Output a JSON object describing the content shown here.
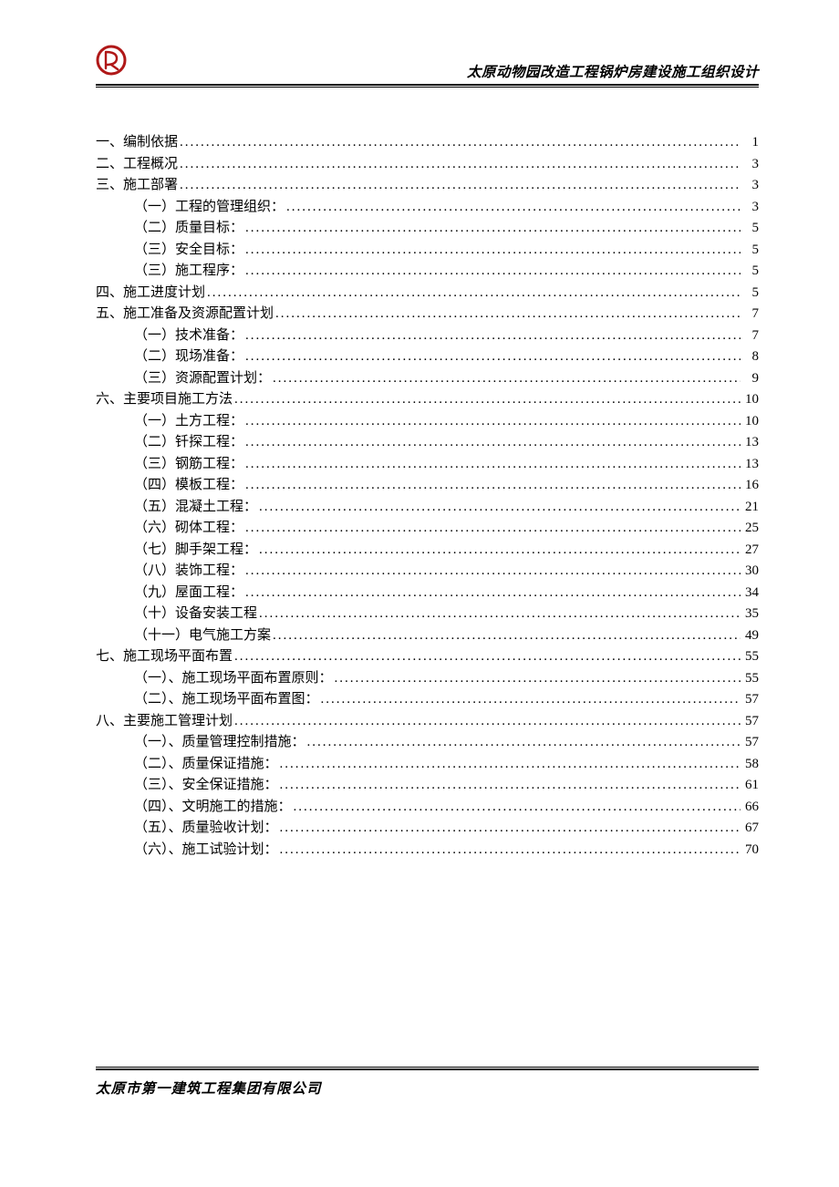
{
  "header": {
    "title": "太原动物园改造工程锅炉房建设施工组织设计"
  },
  "footer": {
    "company": "太原市第一建筑工程集团有限公司"
  },
  "toc": [
    {
      "level": 1,
      "label": "一、编制依据",
      "page": "1"
    },
    {
      "level": 1,
      "label": "二、工程概况",
      "page": "3"
    },
    {
      "level": 1,
      "label": "三、施工部署",
      "page": "3"
    },
    {
      "level": 2,
      "label": "（一）工程的管理组织：",
      "page": "3"
    },
    {
      "level": 2,
      "label": "（二）质量目标：",
      "page": "5"
    },
    {
      "level": 2,
      "label": "（三）安全目标：",
      "page": "5"
    },
    {
      "level": 2,
      "label": "（三）施工程序：",
      "page": "5"
    },
    {
      "level": 1,
      "label": "四、施工进度计划",
      "page": "5"
    },
    {
      "level": 1,
      "label": "五、施工准备及资源配置计划",
      "page": "7"
    },
    {
      "level": 2,
      "label": "（一）技术准备：",
      "page": "7"
    },
    {
      "level": 2,
      "label": "（二）现场准备：",
      "page": "8"
    },
    {
      "level": 2,
      "label": "（三）资源配置计划：",
      "page": "9"
    },
    {
      "level": 1,
      "label": "六、主要项目施工方法",
      "page": "10"
    },
    {
      "level": 2,
      "label": "（一）土方工程：",
      "page": "10"
    },
    {
      "level": 2,
      "label": "（二）钎探工程：",
      "page": "13"
    },
    {
      "level": 2,
      "label": "（三）钢筋工程：",
      "page": "13"
    },
    {
      "level": 2,
      "label": "（四）模板工程：",
      "page": "16"
    },
    {
      "level": 2,
      "label": "（五）混凝土工程：",
      "page": "21"
    },
    {
      "level": 2,
      "label": "（六）砌体工程：",
      "page": "25"
    },
    {
      "level": 2,
      "label": "（七）脚手架工程：",
      "page": "27"
    },
    {
      "level": 2,
      "label": "（八）装饰工程：",
      "page": "30"
    },
    {
      "level": 2,
      "label": "（九）屋面工程：",
      "page": "34"
    },
    {
      "level": 2,
      "label": "（十）设备安装工程",
      "page": "35"
    },
    {
      "level": 2,
      "label": "（十一）电气施工方案",
      "page": "49"
    },
    {
      "level": 1,
      "label": "七、施工现场平面布置",
      "page": "55"
    },
    {
      "level": 2,
      "label": "（一）、施工现场平面布置原则：",
      "page": "55"
    },
    {
      "level": 2,
      "label": "（二）、施工现场平面布置图：",
      "page": "57"
    },
    {
      "level": 1,
      "label": "八、主要施工管理计划",
      "page": "57"
    },
    {
      "level": 2,
      "label": "（一）、质量管理控制措施：",
      "page": "57"
    },
    {
      "level": 2,
      "label": "（二）、质量保证措施：",
      "page": "58"
    },
    {
      "level": 2,
      "label": "（三）、安全保证措施：",
      "page": "61"
    },
    {
      "level": 2,
      "label": "（四）、文明施工的措施：",
      "page": "66"
    },
    {
      "level": 2,
      "label": "（五）、质量验收计划：",
      "page": "67"
    },
    {
      "level": 2,
      "label": "（六）、施工试验计划：",
      "page": "70"
    }
  ]
}
